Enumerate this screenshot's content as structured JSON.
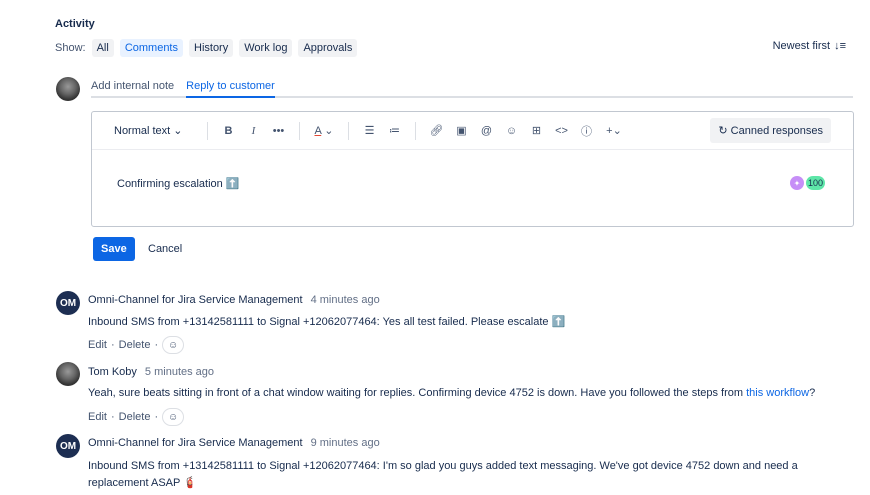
{
  "activity": {
    "title": "Activity",
    "show_label": "Show:",
    "filters": [
      "All",
      "Comments",
      "History",
      "Work log",
      "Approvals"
    ],
    "sort": "Newest first",
    "sort_icon": "sort-descending-icon"
  },
  "compose": {
    "tabs": [
      "Add internal note",
      "Reply to customer"
    ],
    "toolbar": {
      "text_style": "Normal text",
      "canned": "Canned responses"
    },
    "content": "Confirming escalation ⬆️",
    "badge": "100",
    "save": "Save",
    "cancel": "Cancel"
  },
  "comments": [
    {
      "avatar": "OM",
      "author": "Omni-Channel for Jira Service Management",
      "time": "4 minutes ago",
      "body": "Inbound SMS from +13142581111 to Signal +12062077464: Yes all test failed. Please escalate ⬆️",
      "edit": "Edit",
      "delete": "Delete"
    },
    {
      "author": "Tom Koby",
      "time": "5 minutes ago",
      "body": "Yeah, sure beats sitting in front of a chat window waiting for replies. Confirming device 4752 is down. Have you followed the steps from ",
      "link": "this workflow",
      "body_end": "?",
      "edit": "Edit",
      "delete": "Delete"
    },
    {
      "avatar": "OM",
      "author": "Omni-Channel for Jira Service Management",
      "time": "9 minutes ago",
      "body": "Inbound SMS from +13142581111 to Signal +12062077464: I'm so glad you guys added text messaging. We've got device 4752 down and need a replacement ASAP 🧯"
    }
  ]
}
